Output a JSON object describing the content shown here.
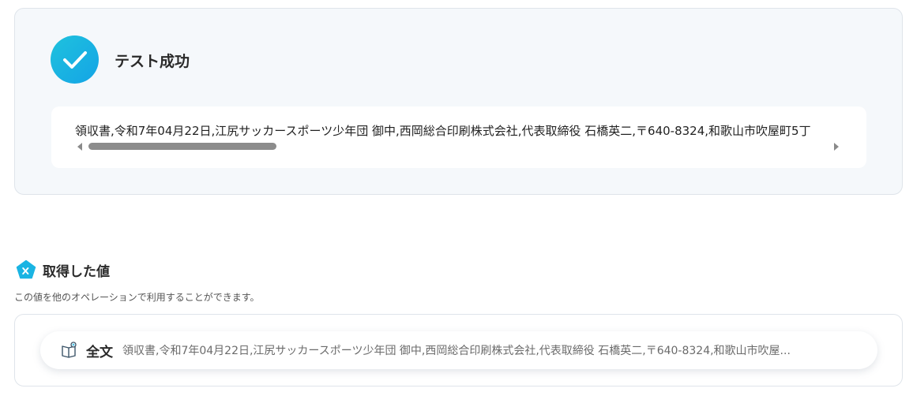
{
  "test_result": {
    "title": "テスト成功",
    "output_text": "領収書,令和7年04月22日,江尻サッカースポーツ少年団 御中,西岡総合印刷株式会社,代表取締役 石橋英二,〒640-8324,和歌山市吹屋町5丁"
  },
  "obtained_values": {
    "title": "取得した値",
    "description": "この値を他のオペレーションで利用することができます。",
    "items": [
      {
        "label": "全文",
        "value": "領収書,令和7年04月22日,江尻サッカースポーツ少年団 御中,西岡総合印刷株式会社,代表取締役 石橋英二,〒640-8324,和歌山市吹屋..."
      }
    ]
  },
  "colors": {
    "accent": "#1ab4e3",
    "panel_bg": "#f5f8fb",
    "border": "#dfe4ea"
  }
}
